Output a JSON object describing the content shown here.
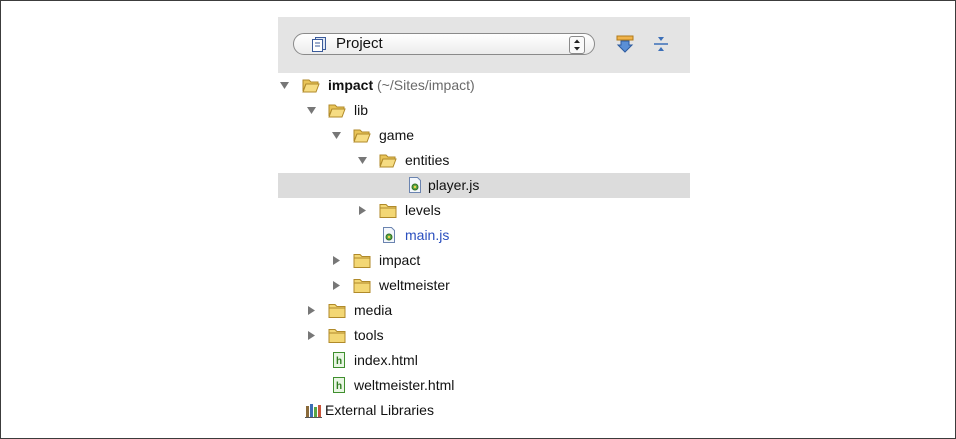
{
  "toolbar": {
    "view_selector_label": "Project",
    "icons": [
      "project-view-icon",
      "autoscroll-icon",
      "collapse-all-icon"
    ]
  },
  "tree": {
    "items": [
      {
        "label": "impact",
        "path": "(~/Sites/impact)",
        "kind": "folder",
        "expanded": true
      },
      {
        "label": "lib",
        "kind": "folder",
        "expanded": true
      },
      {
        "label": "game",
        "kind": "folder",
        "expanded": true
      },
      {
        "label": "entities",
        "kind": "folder",
        "expanded": true
      },
      {
        "label": "player.js",
        "kind": "js-file",
        "selected": true
      },
      {
        "label": "levels",
        "kind": "folder",
        "expanded": false
      },
      {
        "label": "main.js",
        "kind": "js-file",
        "modified": true
      },
      {
        "label": "impact",
        "kind": "folder",
        "expanded": false
      },
      {
        "label": "weltmeister",
        "kind": "folder",
        "expanded": false
      },
      {
        "label": "media",
        "kind": "folder",
        "expanded": false
      },
      {
        "label": "tools",
        "kind": "folder",
        "expanded": false
      },
      {
        "label": "index.html",
        "kind": "html-file"
      },
      {
        "label": "weltmeister.html",
        "kind": "html-file"
      },
      {
        "label": "External Libraries",
        "kind": "libraries"
      }
    ]
  },
  "colors": {
    "toolbar_bg": "#e4e4e4",
    "selection_bg": "#dcdcdc",
    "folder_yellow": "#f2d36b",
    "modified_blue": "#2a4fbf"
  }
}
